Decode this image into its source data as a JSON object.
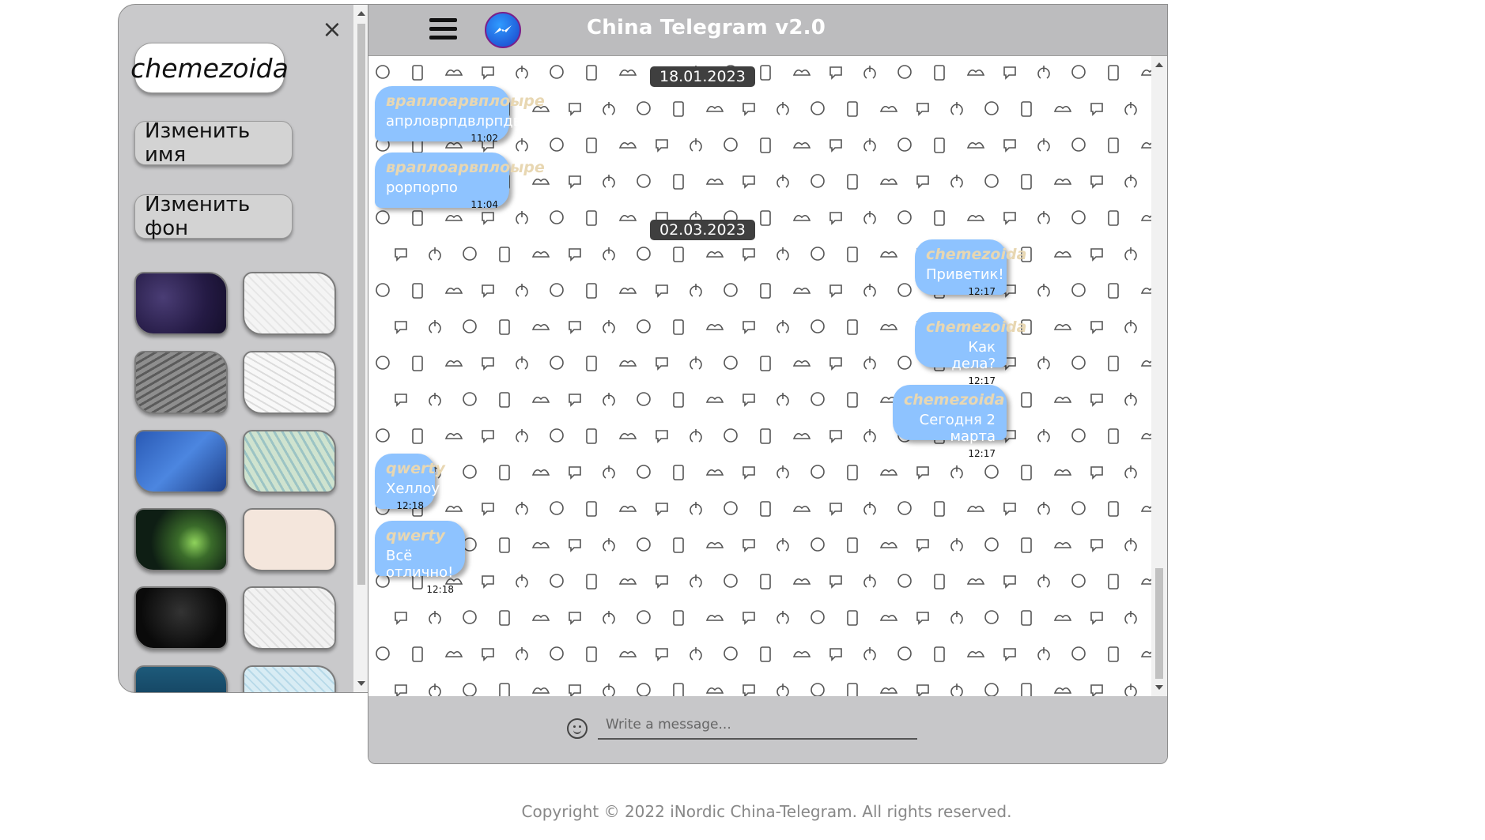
{
  "app": {
    "title": "China Telegram v2.0"
  },
  "icons": {
    "menu": "hamburger-icon",
    "logo": "messenger-logo-icon",
    "close": "close-icon",
    "emoji": "smiley-icon"
  },
  "sidebar": {
    "close_glyph": "×",
    "username": "chemezoida",
    "rename_label": "Изменить имя",
    "background_label": "Изменить фон",
    "backgrounds": [
      "purple-stars",
      "light-doodle",
      "gray-doodle",
      "white-doodle",
      "blue-envelopes",
      "green-floral",
      "night-cat",
      "cream-plain",
      "space-moon",
      "gray-pattern",
      "deep-blue",
      "light-blue-pattern"
    ]
  },
  "messages": {
    "dates": [
      "18.01.2023",
      "02.03.2023"
    ],
    "items": [
      {
        "author": "враплоарвплоыре",
        "text": "апрловрпдвлрпдв",
        "time": "11:02",
        "direction": "in"
      },
      {
        "author": "враплоарвплоыре",
        "text": "рорпорпо",
        "time": "11:04",
        "direction": "in"
      },
      {
        "author": "chemezoida",
        "text": "Приветик!",
        "time": "12:17",
        "direction": "out"
      },
      {
        "author": "chemezoida",
        "text": "Как дела?",
        "time": "12:17",
        "direction": "out"
      },
      {
        "author": "chemezoida",
        "text": "Сегодня 2 марта",
        "time": "12:17",
        "direction": "out"
      },
      {
        "author": "qwerty",
        "text": "Хеллоу",
        "time": "12:18",
        "direction": "in"
      },
      {
        "author": "qwerty",
        "text": "Всё отлично!",
        "time": "12:18",
        "direction": "in"
      }
    ]
  },
  "composer": {
    "placeholder": "Write a message..."
  },
  "footer": {
    "copyright": "Copyright © 2022 iNordic China-Telegram. All rights reserved."
  },
  "colors": {
    "bubble": "#8ec3ff",
    "author": "#e8d7b2",
    "header": "#bcbcbe",
    "panel": "#c9c9cb"
  }
}
